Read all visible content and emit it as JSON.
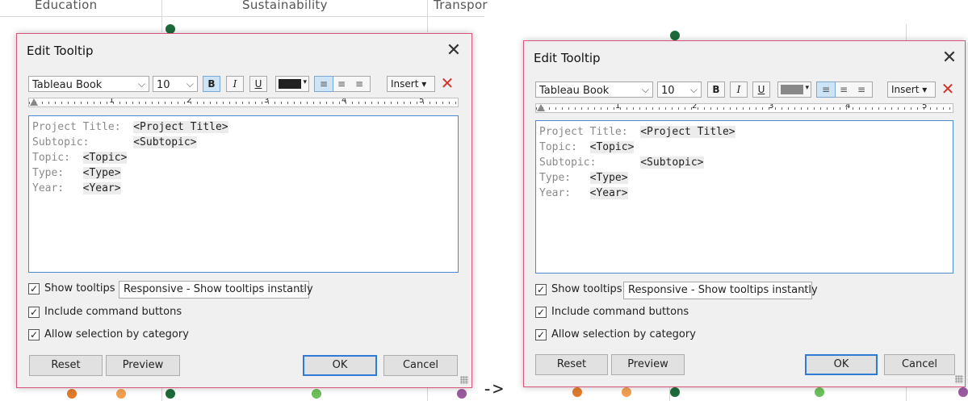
{
  "background": {
    "column_headers": [
      "Education",
      "Sustainability",
      "Transpor"
    ],
    "arrow": "->",
    "dot_colors": {
      "dark_green": "#1e6b3a",
      "orange": "#e07b2b",
      "light_orange": "#f0a050",
      "light_green": "#6cbf5a",
      "purple": "#9b5aa0"
    }
  },
  "dialogs": [
    {
      "title": "Edit Tooltip",
      "close_glyph": "✕",
      "toolbar": {
        "font_name": "Tableau Book",
        "font_size": "10",
        "bold": "B",
        "italic": "I",
        "underline": "U",
        "text_color": "#222222",
        "align_left": "≡",
        "align_center": "≡",
        "align_right": "≡",
        "insert": "Insert ▾",
        "clear": "✕"
      },
      "ruler_numbers": [
        "1",
        "2",
        "3",
        "4",
        "5"
      ],
      "lines": [
        {
          "label": "Project Title:  ",
          "field": "<Project Title>"
        },
        {
          "label": "Subtopic:       ",
          "field": "<Subtopic>"
        },
        {
          "label": "Topic:  ",
          "field": "<Topic>"
        },
        {
          "label": "Type:   ",
          "field": "<Type>"
        },
        {
          "label": "Year:   ",
          "field": "<Year>"
        }
      ],
      "show_tooltips": {
        "label": "Show tooltips",
        "checked": true,
        "mode": "Responsive - Show tooltips instantly"
      },
      "include_command_buttons": {
        "label": "Include command buttons",
        "checked": true
      },
      "allow_selection": {
        "label": "Allow selection by category",
        "checked": true
      },
      "buttons": {
        "reset": "Reset",
        "preview": "Preview",
        "ok": "OK",
        "cancel": "Cancel"
      },
      "check_glyph": "✓",
      "chevron": "⌵"
    },
    {
      "title": "Edit Tooltip",
      "close_glyph": "✕",
      "toolbar": {
        "font_name": "Tableau Book",
        "font_size": "10",
        "bold": "B",
        "italic": "I",
        "underline": "U",
        "text_color": "#888888",
        "align_left": "≡",
        "align_center": "≡",
        "align_right": "≡",
        "insert": "Insert ▾",
        "clear": "✕"
      },
      "ruler_numbers": [
        "1",
        "2",
        "3",
        "4",
        "5"
      ],
      "lines": [
        {
          "label": "Project Title:  ",
          "field": "<Project Title>"
        },
        {
          "label": "Topic:  ",
          "field": "<Topic>"
        },
        {
          "label": "Subtopic:       ",
          "field": "<Subtopic>"
        },
        {
          "label": "Type:   ",
          "field": "<Type>"
        },
        {
          "label": "Year:   ",
          "field": "<Year>"
        }
      ],
      "show_tooltips": {
        "label": "Show tooltips",
        "checked": true,
        "mode": "Responsive - Show tooltips instantly"
      },
      "include_command_buttons": {
        "label": "Include command buttons",
        "checked": true
      },
      "allow_selection": {
        "label": "Allow selection by category",
        "checked": true
      },
      "buttons": {
        "reset": "Reset",
        "preview": "Preview",
        "ok": "OK",
        "cancel": "Cancel"
      },
      "check_glyph": "✓",
      "chevron": "⌵"
    }
  ]
}
